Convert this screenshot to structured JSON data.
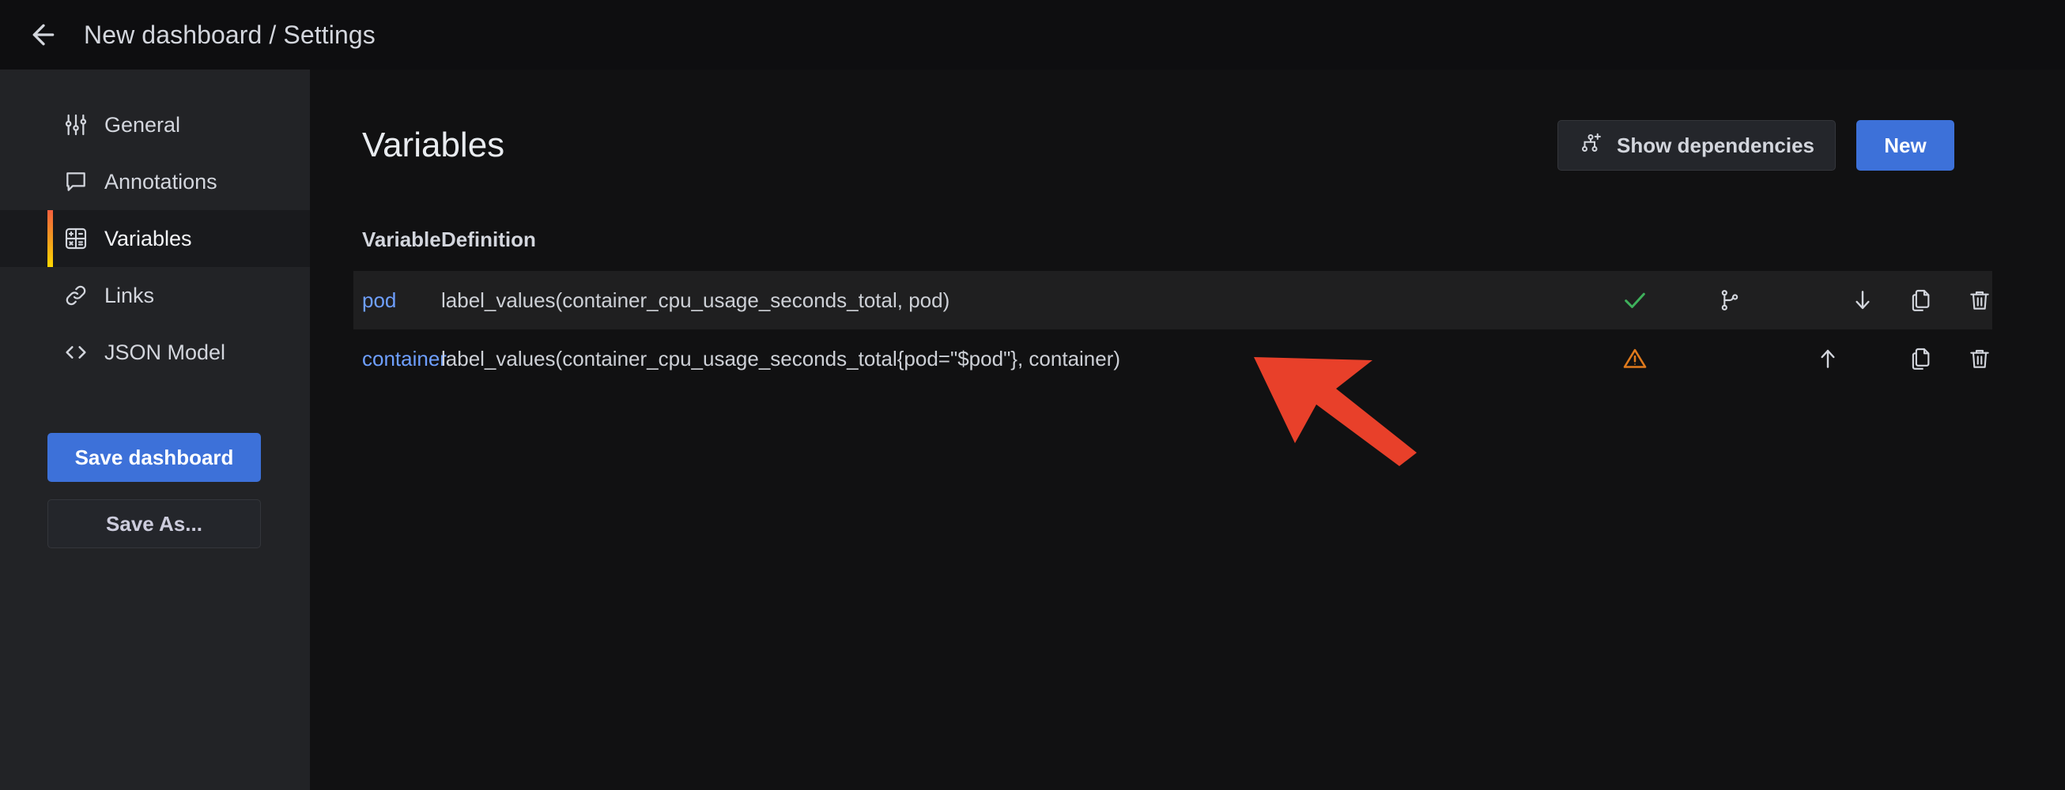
{
  "topbar": {
    "back_icon": "arrow-left-icon",
    "title": "New dashboard / Settings"
  },
  "sidebar": {
    "items": [
      {
        "label": "General",
        "icon": "sliders-icon",
        "active": false
      },
      {
        "label": "Annotations",
        "icon": "comment-icon",
        "active": false
      },
      {
        "label": "Variables",
        "icon": "calculator-icon",
        "active": true
      },
      {
        "label": "Links",
        "icon": "link-icon",
        "active": false
      },
      {
        "label": "JSON Model",
        "icon": "code-icon",
        "active": false
      }
    ],
    "save_dashboard_label": "Save dashboard",
    "save_as_label": "Save As..."
  },
  "main": {
    "page_title": "Variables",
    "show_dependencies_label": "Show dependencies",
    "show_dependencies_icon": "sitemap-add-icon",
    "new_label": "New",
    "table": {
      "headers": {
        "variable": "Variable",
        "definition": "Definition"
      },
      "rows": [
        {
          "variable": "pod",
          "definition": "label_values(container_cpu_usage_seconds_total, pod)",
          "status_icon": "check-icon",
          "status_color": "#3eb15b",
          "dependency_icon": "code-branch-icon",
          "move_icon": "arrow-down-icon",
          "duplicate_icon": "copy-icon",
          "delete_icon": "trash-icon",
          "hovered": true
        },
        {
          "variable": "container",
          "definition": "label_values(container_cpu_usage_seconds_total{pod=\"$pod\"}, container)",
          "status_icon": "warning-triangle-icon",
          "status_color": "#e07a1c",
          "dependency_icon": null,
          "move_icon": "arrow-up-icon",
          "duplicate_icon": "copy-icon",
          "delete_icon": "trash-icon",
          "hovered": false
        }
      ]
    }
  },
  "annotation": {
    "arrow_color": "#e8402a",
    "arrow_name": "red-pointer-arrow"
  },
  "colors": {
    "accent_blue": "#3d71d9",
    "link_blue": "#6e9fff",
    "sidebar_bg": "#222326",
    "main_bg": "#111112",
    "topbar_bg": "#0e0e10",
    "row_hover": "#1f1f20"
  }
}
